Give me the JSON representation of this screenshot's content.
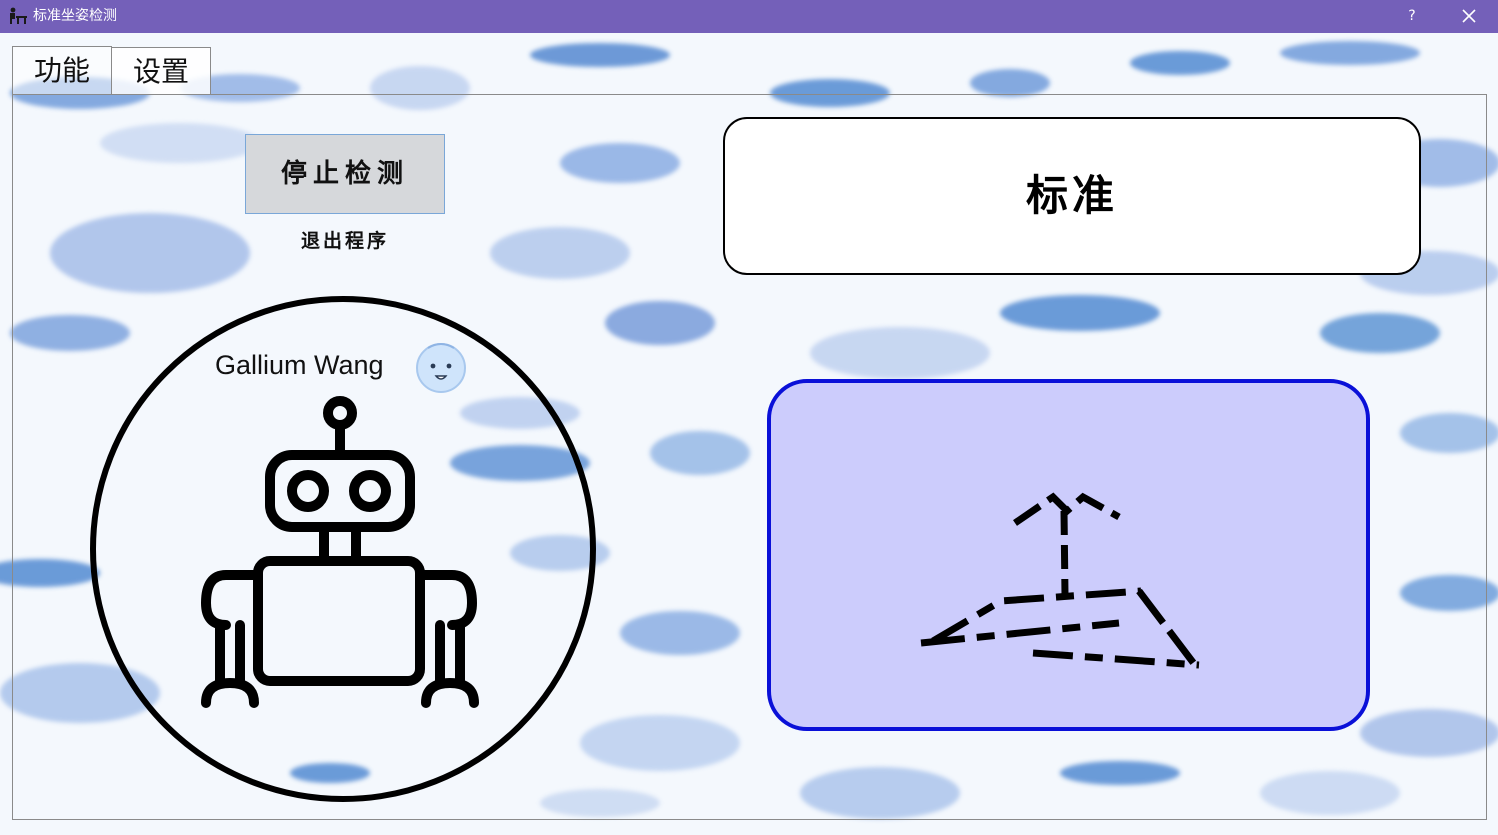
{
  "window": {
    "title": "标准坐姿检测",
    "help_label": "?",
    "app_icon": "desk-person-icon",
    "close_icon": "close-icon"
  },
  "tabs": [
    {
      "label": "功能",
      "active": true
    },
    {
      "label": "设置",
      "active": false
    }
  ],
  "controls": {
    "stop_button": "停止检测",
    "exit_link": "退出程序"
  },
  "profile": {
    "author": "Gallium Wang",
    "avatar_icon": "smiley-face-icon",
    "illustration": "robot-icon"
  },
  "posture": {
    "status": "标准",
    "skeleton_icon": "pose-skeleton-icon"
  },
  "colors": {
    "titlebar": "#7460b9",
    "pose_fill": "#ccccfc",
    "pose_border": "#0a10d8",
    "stop_button_bg": "#d6d8db"
  }
}
